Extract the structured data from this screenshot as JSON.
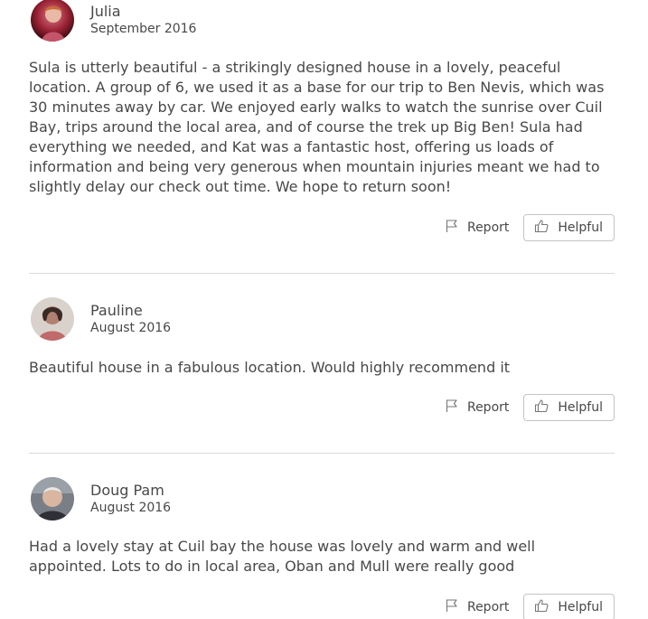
{
  "reviews": [
    {
      "name": "Julia",
      "date": "September 2016",
      "text": "Sula is utterly beautiful - a strikingly designed house in a lovely, peaceful location. A group of 6, we used it as a base for our trip to Ben Nevis, which was 30 minutes away by car. We enjoyed early walks to watch the sunrise over Cuil Bay, trips around the local area, and of course the trek up Big Ben! Sula had everything we needed, and Kat was a fantastic host, offering us loads of information and being very generous when mountain injuries meant we had to slightly delay our check out time. We hope to return soon!",
      "report_label": "Report",
      "helpful_label": "Helpful"
    },
    {
      "name": "Pauline",
      "date": "August 2016",
      "text": "Beautiful house in a fabulous location. Would highly recommend it",
      "report_label": "Report",
      "helpful_label": "Helpful"
    },
    {
      "name": "Doug Pam",
      "date": "August 2016",
      "text": "Had a lovely stay at Cuil bay the house was lovely and warm and well appointed. Lots to do in local area, Oban and Mull were really good",
      "report_label": "Report",
      "helpful_label": "Helpful"
    }
  ],
  "icons": {
    "report": "flag-icon",
    "helpful": "thumbs-up-icon"
  }
}
